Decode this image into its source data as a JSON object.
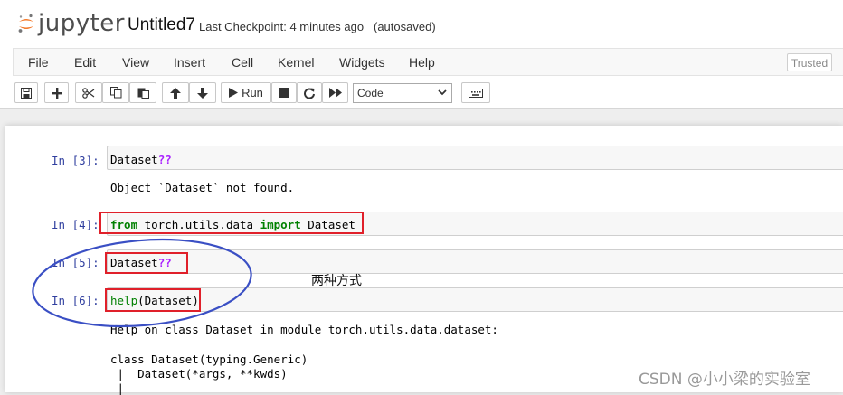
{
  "header": {
    "logo_text": "jupyter",
    "notebook_title": "Untitled7",
    "checkpoint": "Last Checkpoint: 4 minutes ago",
    "autosave": "(autosaved)",
    "trusted": "Trusted"
  },
  "menu": [
    "File",
    "Edit",
    "View",
    "Insert",
    "Cell",
    "Kernel",
    "Widgets",
    "Help"
  ],
  "toolbar": {
    "run_label": "Run",
    "cell_type": "Code",
    "cell_type_options": [
      "Code"
    ]
  },
  "cells": [
    {
      "prompt": "In [3]:",
      "code_plain": "Dataset",
      "code_op": "??",
      "output": "Object `Dataset` not found."
    },
    {
      "prompt": "In [4]:",
      "kw1": "from",
      "mod": " torch.utils.data ",
      "kw2": "import",
      "name": " Dataset"
    },
    {
      "prompt": "In [5]:",
      "code_plain": "Dataset",
      "code_op": "??"
    },
    {
      "prompt": "In [6]:",
      "builtin": "help",
      "args": "(Dataset)",
      "output_lines": [
        "Help on class Dataset in module torch.utils.data.dataset:",
        "",
        "class Dataset(typing.Generic)",
        " |  Dataset(*args, **kwds)",
        " |"
      ]
    }
  ],
  "annotation": "两种方式",
  "watermark": "CSDN @小小梁的实验室",
  "colors": {
    "accent_red": "#e0202a",
    "ellipse_blue": "#3a4fc4",
    "prompt_blue": "#303f9f",
    "keyword_green": "#008000",
    "operator_purple": "#aa22ff",
    "logo_orange": "#f37726"
  }
}
